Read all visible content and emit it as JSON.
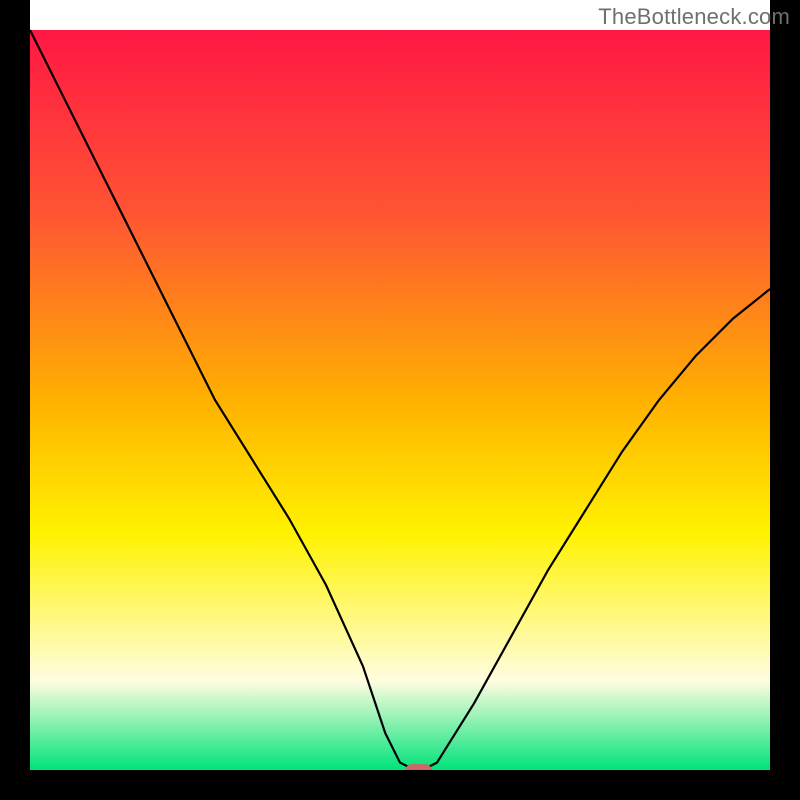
{
  "watermark": "TheBottleneck.com",
  "colors": {
    "gradient_top": "#ff1744",
    "gradient_mid1": "#ff5533",
    "gradient_mid2": "#ffb100",
    "gradient_mid3": "#fff200",
    "gradient_mid4": "#fffde0",
    "gradient_bottom": "#00e37a",
    "curve": "#000000",
    "marker": "#cb6868",
    "frame": "#000000"
  },
  "chart_data": {
    "type": "line",
    "title": "",
    "xlabel": "",
    "ylabel": "",
    "xlim": [
      0,
      100
    ],
    "ylim": [
      0,
      100
    ],
    "series": [
      {
        "name": "bottleneck-curve",
        "x": [
          0,
          5,
          10,
          15,
          20,
          25,
          30,
          35,
          40,
          45,
          48,
          50,
          52,
          53,
          55,
          60,
          65,
          70,
          75,
          80,
          85,
          90,
          95,
          100
        ],
        "values": [
          100,
          90,
          80,
          70,
          60,
          50,
          42,
          34,
          25,
          14,
          5,
          1,
          0,
          0,
          1,
          9,
          18,
          27,
          35,
          43,
          50,
          56,
          61,
          65
        ]
      }
    ],
    "marker": {
      "x": 52.5,
      "y": 0,
      "width": 3.5,
      "height": 1.6
    }
  }
}
